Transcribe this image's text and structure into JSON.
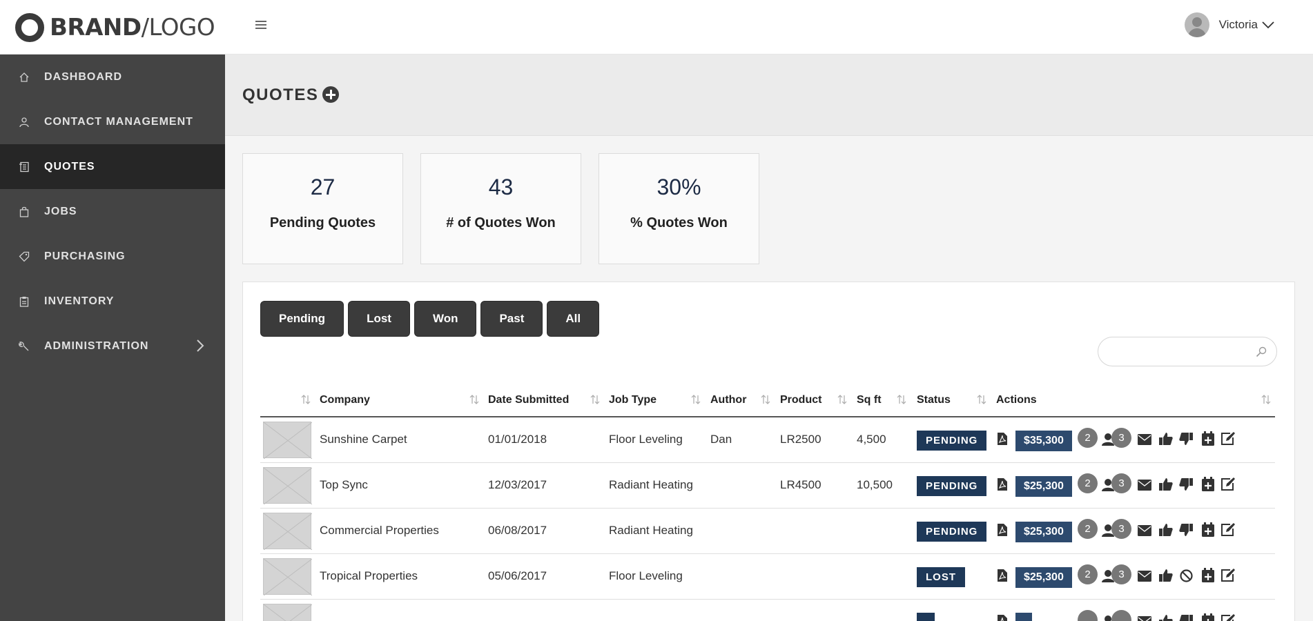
{
  "brand": {
    "bold": "BRAND",
    "light": "/LOGO"
  },
  "user": {
    "name": "Victoria"
  },
  "sidebar": {
    "items": [
      {
        "label": "DASHBOARD",
        "icon": "home-icon"
      },
      {
        "label": "CONTACT MANAGEMENT",
        "icon": "user-icon"
      },
      {
        "label": "QUOTES",
        "icon": "quote-icon",
        "active": true
      },
      {
        "label": "JOBS",
        "icon": "bag-icon"
      },
      {
        "label": "PURCHASING",
        "icon": "tag-icon"
      },
      {
        "label": "INVENTORY",
        "icon": "clipboard-icon"
      },
      {
        "label": "ADMINISTRATION",
        "icon": "wrench-icon",
        "has_submenu": true
      }
    ]
  },
  "page": {
    "title": "QUOTES"
  },
  "stats": [
    {
      "value": "27",
      "label": "Pending Quotes"
    },
    {
      "value": "43",
      "label": "# of Quotes Won"
    },
    {
      "value": "30%",
      "label": "% Quotes Won"
    }
  ],
  "filters": [
    "Pending",
    "Lost",
    "Won",
    "Past",
    "All"
  ],
  "search": {
    "placeholder": ""
  },
  "table": {
    "columns": [
      "Company",
      "Date Submitted",
      "Job Type",
      "Author",
      "Product",
      "Sq ft",
      "Status",
      "Actions"
    ],
    "rows": [
      {
        "company": "Sunshine Carpet",
        "date": "01/01/2018",
        "job_type": "Floor Leveling",
        "author": "Dan",
        "product": "LR2500",
        "sqft": "4,500",
        "status": "PENDING",
        "price": "$35,300",
        "badge1": "2",
        "badge2": "3",
        "last_action": "thumbs-down-icon"
      },
      {
        "company": "Top Sync",
        "date": "12/03/2017",
        "job_type": "Radiant Heating",
        "author": "",
        "product": "LR4500",
        "sqft": "10,500",
        "status": "PENDING",
        "price": "$25,300",
        "badge1": "2",
        "badge2": "3",
        "last_action": "thumbs-down-icon"
      },
      {
        "company": "Commercial Properties",
        "date": "06/08/2017",
        "job_type": "Radiant Heating",
        "author": "",
        "product": "",
        "sqft": "",
        "status": "PENDING",
        "price": "$25,300",
        "badge1": "2",
        "badge2": "3",
        "last_action": "thumbs-down-icon"
      },
      {
        "company": "Tropical Properties",
        "date": "05/06/2017",
        "job_type": "Floor Leveling",
        "author": "",
        "product": "",
        "sqft": "",
        "status": "LOST",
        "price": "$25,300",
        "badge1": "2",
        "badge2": "3",
        "last_action": "ban-icon"
      },
      {
        "company": "",
        "date": "",
        "job_type": "",
        "author": "",
        "product": "",
        "sqft": "",
        "status": "",
        "price": "",
        "badge1": "",
        "badge2": "",
        "last_action": "thumbs-down-icon"
      }
    ]
  },
  "colors": {
    "sidebar": "#444444",
    "sidebar_active": "#262626",
    "status_badge": "#1e3858",
    "price_badge": "#2d4a6e",
    "filter_button": "#3b3b3b"
  }
}
